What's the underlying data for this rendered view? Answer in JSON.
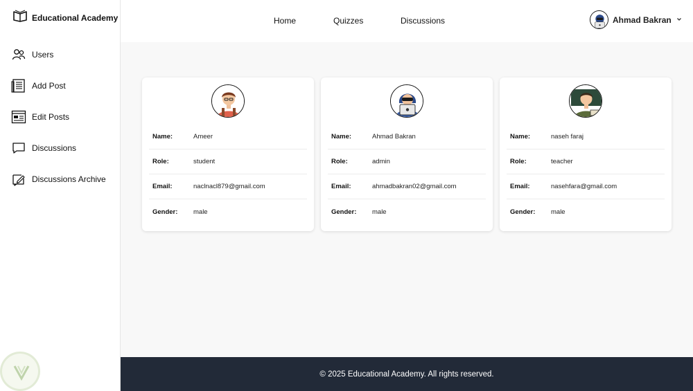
{
  "brand": {
    "name": "Educational Academy",
    "icon": "open-book-icon"
  },
  "sidebar": {
    "items": [
      {
        "label": "Users",
        "icon": "users-icon"
      },
      {
        "label": "Add Post",
        "icon": "add-post-icon"
      },
      {
        "label": "Edit Posts",
        "icon": "edit-posts-icon"
      },
      {
        "label": "Discussions",
        "icon": "chat-bubble-icon"
      },
      {
        "label": "Discussions Archive",
        "icon": "archive-edit-icon"
      }
    ]
  },
  "topnav": {
    "home": "Home",
    "quizzes": "Quizzes",
    "discussions": "Discussions"
  },
  "user": {
    "name": "Ahmad Bakran",
    "menu_icon": "chevron-down-icon"
  },
  "labels": {
    "name": "Name:",
    "role": "Role:",
    "email": "Email:",
    "gender": "Gender:"
  },
  "users": [
    {
      "name": "Ameer",
      "role": "student",
      "email": "naclnacl879@gmail.com",
      "gender": "male",
      "avatar": "student-avatar"
    },
    {
      "name": "Ahmad Bakran",
      "role": "admin",
      "email": "ahmadbakran02@gmail.com",
      "gender": "male",
      "avatar": "hacker-laptop-avatar"
    },
    {
      "name": "naseh faraj",
      "role": "teacher",
      "email": "nasehfara@gmail.com",
      "gender": "male",
      "avatar": "teacher-avatar"
    }
  ],
  "footer": {
    "text": "© 2025 Educational Academy. All rights reserved."
  },
  "colors": {
    "footer_bg": "#222a38",
    "page_bg": "#f8f8f8",
    "card_bg": "#ffffff"
  }
}
